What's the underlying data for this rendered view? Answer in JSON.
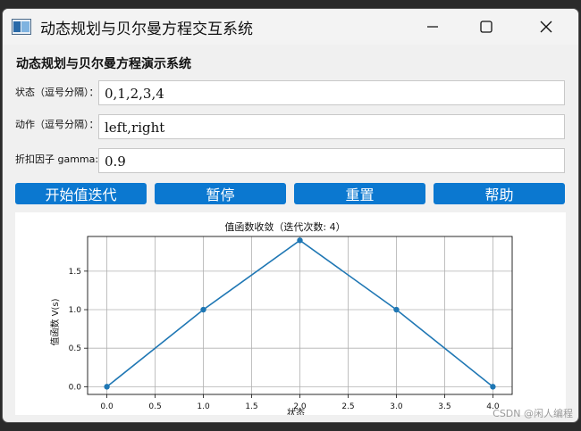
{
  "window": {
    "title": "动态规划与贝尔曼方程交互系统"
  },
  "header": {
    "title": "动态规划与贝尔曼方程演示系统"
  },
  "fields": {
    "states_label": "状态（逗号分隔）：",
    "states_value": "0,1,2,3,4",
    "actions_label": "动作（逗号分隔）：",
    "actions_value": "left,right",
    "gamma_label": "折扣因子 gamma:",
    "gamma_value": "0.9"
  },
  "buttons": {
    "start": "开始值迭代",
    "pause": "暂停",
    "reset": "重置",
    "help": "帮助"
  },
  "colors": {
    "button_bg": "#0b78d0",
    "line": "#1f77b4"
  },
  "chart_data": {
    "type": "line",
    "title": "值函数收敛（迭代次数: 4）",
    "xlabel": "状态",
    "ylabel": "值函数 V(s)",
    "x": [
      0,
      1,
      2,
      3,
      4
    ],
    "values": [
      0.0,
      1.0,
      1.9,
      1.0,
      0.0
    ],
    "xlim": [
      -0.2,
      4.2
    ],
    "ylim": [
      -0.1,
      1.95
    ],
    "xticks": [
      "0.0",
      "0.5",
      "1.0",
      "1.5",
      "2.0",
      "2.5",
      "3.0",
      "3.5",
      "4.0"
    ],
    "yticks": [
      "0.0",
      "0.5",
      "1.0",
      "1.5"
    ],
    "grid": true
  },
  "watermark": "CSDN @闲人编程"
}
